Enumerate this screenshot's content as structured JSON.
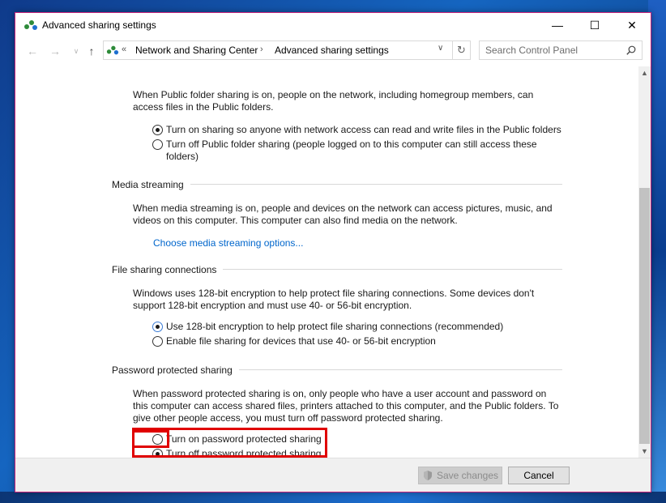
{
  "window": {
    "title": "Advanced sharing settings",
    "controls": {
      "minimize": "—",
      "maximize": "☐",
      "close": "✕"
    }
  },
  "nav": {
    "back": "←",
    "forward": "→",
    "recent": "∨",
    "up": "↑",
    "address_overflow": "«",
    "breadcrumb": [
      "Network and Sharing Center",
      "Advanced sharing settings"
    ],
    "separator": "›",
    "dropdown": "∨",
    "refresh": "↻",
    "search_placeholder": "Search Control Panel"
  },
  "public_folder": {
    "description": "When Public folder sharing is on, people on the network, including homegroup members, can access files in the Public folders.",
    "options": [
      {
        "label": "Turn on sharing so anyone with network access can read and write files in the Public folders",
        "checked": true
      },
      {
        "label": "Turn off Public folder sharing (people logged on to this computer can still access these folders)",
        "checked": false
      }
    ]
  },
  "media_streaming": {
    "heading": "Media streaming",
    "description": "When media streaming is on, people and devices on the network can access pictures, music, and videos on this computer. This computer can also find media on the network.",
    "link": "Choose media streaming options..."
  },
  "file_sharing": {
    "heading": "File sharing connections",
    "description": "Windows uses 128-bit encryption to help protect file sharing connections. Some devices don't support 128-bit encryption and must use 40- or 56-bit encryption.",
    "options": [
      {
        "label": "Use 128-bit encryption to help protect file sharing connections (recommended)",
        "checked": true
      },
      {
        "label": "Enable file sharing for devices that use 40- or 56-bit encryption",
        "checked": false
      }
    ]
  },
  "password_sharing": {
    "heading": "Password protected sharing",
    "description": "When password protected sharing is on, only people who have a user account and password on this computer can access shared files, printers attached to this computer, and the Public folders. To give other people access, you must turn off password protected sharing.",
    "options": [
      {
        "label": "Turn on password protected sharing",
        "checked": false
      },
      {
        "label": "Turn off password protected sharing",
        "checked": true
      }
    ]
  },
  "footer": {
    "save": "Save changes",
    "cancel": "Cancel"
  },
  "scrollbar": {
    "up": "▲",
    "down": "▼"
  },
  "colors": {
    "link": "#0066cc",
    "highlight": "#e00000",
    "border": "#c9237a"
  }
}
